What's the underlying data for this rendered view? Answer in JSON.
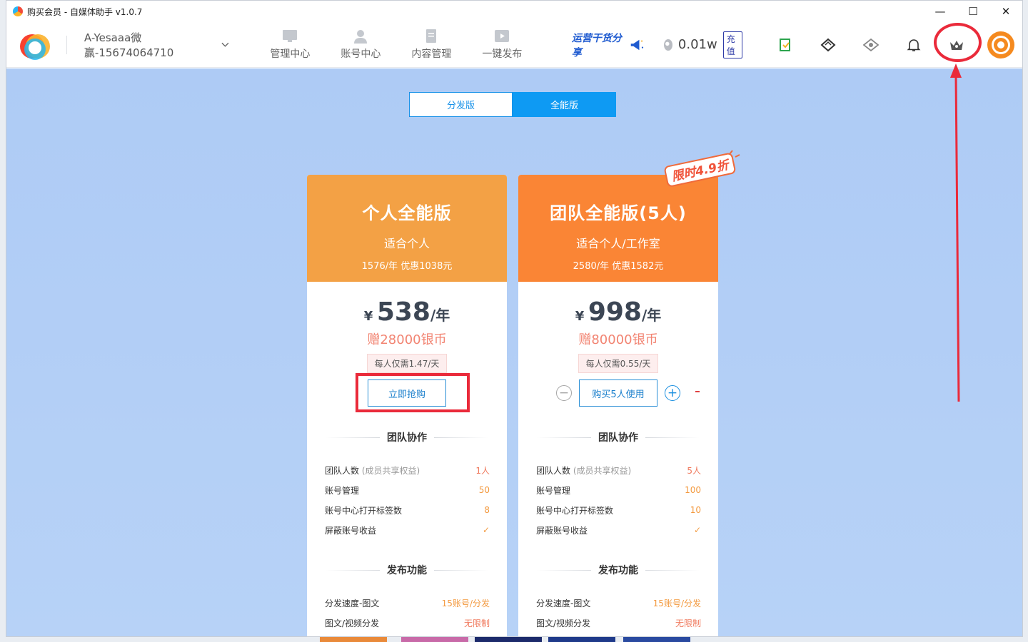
{
  "window": {
    "title": "购买会员 - 自媒体助手 v1.0.7",
    "controls": [
      "—",
      "☐",
      "✕"
    ]
  },
  "header": {
    "account": "A-Yesaaa微赢-15674064710",
    "nav": [
      {
        "label": "管理中心",
        "icon": "monitor-icon"
      },
      {
        "label": "账号中心",
        "icon": "user-icon"
      },
      {
        "label": "内容管理",
        "icon": "document-icon"
      },
      {
        "label": "一键发布",
        "icon": "play-icon"
      }
    ],
    "promo": "运营干货分享",
    "coin_value": "0.01w",
    "recharge": "充值",
    "tools": [
      "clipboard-icon",
      "diamond-icon",
      "radar-icon",
      "bell-icon",
      "crown-icon"
    ]
  },
  "switch": {
    "tab1": "分发版",
    "tab2": "全能版",
    "active": "全能版"
  },
  "badge": "限时4.9折",
  "plans": [
    {
      "name": "个人全能版",
      "sub": "适合个人",
      "orig": "1576/年 优惠1038元",
      "currency": "¥",
      "price": "538",
      "unit": "/年",
      "bonus": "赠28000银币",
      "perday": "每人仅需1.47/天",
      "button": "立即抢购",
      "sections": [
        {
          "title": "团队协作",
          "rows": [
            {
              "label": "团队人数",
              "note": "(成员共享权益)",
              "value": "1人"
            },
            {
              "label": "账号管理",
              "note": "",
              "value": "50"
            },
            {
              "label": "账号中心打开标签数",
              "note": "",
              "value": "8"
            },
            {
              "label": "屏蔽账号收益",
              "note": "",
              "value": "✓"
            }
          ]
        },
        {
          "title": "发布功能",
          "rows": [
            {
              "label": "分发速度-图文",
              "note": "",
              "value": "15账号/分发"
            },
            {
              "label": "图文/视频分发",
              "note": "",
              "value": "无限制"
            }
          ]
        }
      ]
    },
    {
      "name": "团队全能版(5人)",
      "sub": "适合个人/工作室",
      "orig": "2580/年 优惠1582元",
      "currency": "¥",
      "price": "998",
      "unit": "/年",
      "bonus": "赠80000银币",
      "perday": "每人仅需0.55/天",
      "button": "购买5人使用",
      "sections": [
        {
          "title": "团队协作",
          "rows": [
            {
              "label": "团队人数",
              "note": "(成员共享权益)",
              "value": "5人"
            },
            {
              "label": "账号管理",
              "note": "",
              "value": "100"
            },
            {
              "label": "账号中心打开标签数",
              "note": "",
              "value": "10"
            },
            {
              "label": "屏蔽账号收益",
              "note": "",
              "value": "✓"
            }
          ]
        },
        {
          "title": "发布功能",
          "rows": [
            {
              "label": "分发速度-图文",
              "note": "",
              "value": "15账号/分发"
            },
            {
              "label": "图文/视频分发",
              "note": "",
              "value": "无限制"
            }
          ]
        }
      ]
    }
  ],
  "colors": {
    "accent": "#0e9af3",
    "card1": "#f3a145",
    "card2": "#fa8535",
    "highlight": "#ea2a3a",
    "background": "#aecbf5"
  }
}
